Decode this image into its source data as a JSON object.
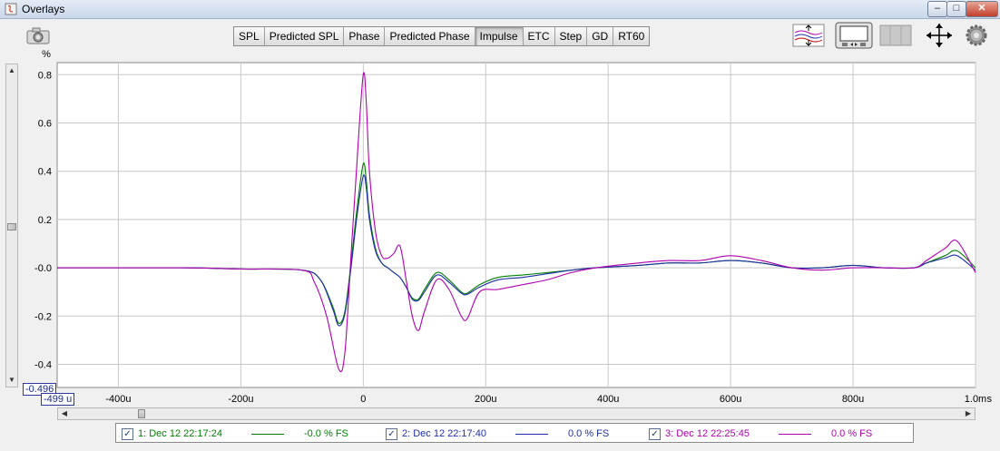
{
  "window": {
    "title": "Overlays"
  },
  "window_buttons": {
    "minimize": "–",
    "maximize": "□",
    "close": "✕"
  },
  "tabs": [
    {
      "label": "SPL",
      "active": false
    },
    {
      "label": "Predicted SPL",
      "active": false
    },
    {
      "label": "Phase",
      "active": false
    },
    {
      "label": "Predicted Phase",
      "active": false
    },
    {
      "label": "Impulse",
      "active": true
    },
    {
      "label": "ETC",
      "active": false
    },
    {
      "label": "Step",
      "active": false
    },
    {
      "label": "GD",
      "active": false
    },
    {
      "label": "RT60",
      "active": false
    }
  ],
  "toolbar_icons": [
    "vertical-zoom-icon",
    "display-mode-icon",
    "grid-icon",
    "move-arrows-icon",
    "gear-icon"
  ],
  "colors": {
    "series1": "#008000",
    "series2": "#1f2fa8",
    "series3": "#b000b0",
    "grid": "#c8c8c8",
    "axis_text": "#000000"
  },
  "readouts": {
    "y_cursor": "-0.496",
    "x_cursor": "-499 u"
  },
  "chart_data": {
    "type": "line",
    "ylabel": "%",
    "xunit": "s",
    "xlim": [
      -0.0005,
      0.001
    ],
    "ylim": [
      -0.496,
      0.85
    ],
    "xticks": [
      {
        "value": -0.0004,
        "label": "-400u"
      },
      {
        "value": -0.0002,
        "label": "-200u"
      },
      {
        "value": 0,
        "label": "0"
      },
      {
        "value": 0.0002,
        "label": "200u"
      },
      {
        "value": 0.0004,
        "label": "400u"
      },
      {
        "value": 0.0006,
        "label": "600u"
      },
      {
        "value": 0.0008,
        "label": "800u"
      },
      {
        "value": 0.001,
        "label": "1.0m"
      }
    ],
    "yticks": [
      {
        "value": 0.8,
        "label": "0.8"
      },
      {
        "value": 0.6,
        "label": "0.6"
      },
      {
        "value": 0.4,
        "label": "0.4"
      },
      {
        "value": 0.2,
        "label": "0.2"
      },
      {
        "value": 0.0,
        "label": "-0.0"
      },
      {
        "value": -0.2,
        "label": "-0.2"
      },
      {
        "value": -0.4,
        "label": "-0.4"
      }
    ],
    "grid": true,
    "series": [
      {
        "name": "1: Dec 12 22:17:24",
        "legend_value": "-0.0 % FS",
        "color": "#008000",
        "checked": true,
        "x": [
          -0.0005,
          -0.0003,
          -0.0002,
          -0.0001,
          -7e-05,
          -5e-05,
          -4e-05,
          -3e-05,
          -2e-05,
          -1e-05,
          0,
          5e-06,
          1e-05,
          2e-05,
          3e-05,
          4e-05,
          5e-05,
          6e-05,
          7e-05,
          8e-05,
          9e-05,
          0.0001,
          0.00012,
          0.00014,
          0.00016,
          0.00017,
          0.00019,
          0.00022,
          0.00026,
          0.0003,
          0.00034,
          0.00038,
          0.00045,
          0.0005,
          0.00055,
          0.0006,
          0.00065,
          0.0007,
          0.00075,
          0.0008,
          0.00085,
          0.0009,
          0.00092,
          0.00095,
          0.00097,
          0.001
        ],
        "y": [
          0,
          0,
          -0.005,
          -0.01,
          -0.05,
          -0.16,
          -0.23,
          -0.18,
          0.02,
          0.25,
          0.43,
          0.36,
          0.22,
          0.08,
          0.02,
          0.0,
          -0.02,
          -0.04,
          -0.08,
          -0.125,
          -0.13,
          -0.09,
          -0.02,
          -0.05,
          -0.1,
          -0.105,
          -0.07,
          -0.04,
          -0.03,
          -0.02,
          -0.01,
          0.0,
          0.01,
          0.02,
          0.02,
          0.03,
          0.02,
          0.0,
          0.0,
          0.01,
          0.0,
          0.0,
          0.02,
          0.05,
          0.07,
          0.0
        ]
      },
      {
        "name": "2: Dec 12 22:17:40",
        "legend_value": "0.0 % FS",
        "color": "#1f2fa8",
        "checked": true,
        "x": [
          -0.0005,
          -0.0003,
          -0.0002,
          -0.0001,
          -7e-05,
          -5e-05,
          -4e-05,
          -3e-05,
          -2e-05,
          -1e-05,
          0,
          5e-06,
          1e-05,
          2e-05,
          3e-05,
          4e-05,
          5e-05,
          6e-05,
          7e-05,
          8e-05,
          9e-05,
          0.0001,
          0.00012,
          0.00014,
          0.00016,
          0.00017,
          0.00019,
          0.00022,
          0.00026,
          0.0003,
          0.00034,
          0.00038,
          0.00045,
          0.0005,
          0.00055,
          0.0006,
          0.00065,
          0.0007,
          0.00075,
          0.0008,
          0.00085,
          0.0009,
          0.00092,
          0.00095,
          0.00097,
          0.001
        ],
        "y": [
          0,
          0,
          -0.005,
          -0.01,
          -0.05,
          -0.17,
          -0.24,
          -0.19,
          0.0,
          0.22,
          0.38,
          0.33,
          0.2,
          0.07,
          0.02,
          0.0,
          -0.02,
          -0.04,
          -0.08,
          -0.13,
          -0.135,
          -0.1,
          -0.03,
          -0.06,
          -0.105,
          -0.11,
          -0.08,
          -0.05,
          -0.04,
          -0.025,
          -0.01,
          0.0,
          0.01,
          0.02,
          0.02,
          0.03,
          0.02,
          0.0,
          0.0,
          0.01,
          0.0,
          0.0,
          0.02,
          0.04,
          0.05,
          -0.01
        ]
      },
      {
        "name": "3: Dec 12 22:25:45",
        "legend_value": "0.0 % FS",
        "color": "#b000b0",
        "checked": true,
        "x": [
          -0.0005,
          -0.0003,
          -0.0002,
          -0.0001,
          -8e-05,
          -6e-05,
          -4e-05,
          -3e-05,
          -2e-05,
          -1e-05,
          0,
          5e-06,
          1e-05,
          2e-05,
          3e-05,
          4e-05,
          5e-05,
          6e-05,
          7e-05,
          8e-05,
          9e-05,
          0.0001,
          0.00012,
          0.00014,
          0.00016,
          0.00017,
          0.00019,
          0.00022,
          0.00026,
          0.0003,
          0.00034,
          0.00038,
          0.00045,
          0.0005,
          0.00055,
          0.0006,
          0.00065,
          0.0007,
          0.00075,
          0.0008,
          0.00085,
          0.0009,
          0.00092,
          0.00095,
          0.00097,
          0.001
        ],
        "y": [
          0,
          0,
          -0.005,
          -0.01,
          -0.06,
          -0.2,
          -0.42,
          -0.35,
          0.05,
          0.45,
          0.8,
          0.68,
          0.4,
          0.15,
          0.05,
          0.04,
          0.06,
          0.09,
          -0.05,
          -0.2,
          -0.26,
          -0.18,
          -0.05,
          -0.09,
          -0.2,
          -0.21,
          -0.1,
          -0.09,
          -0.07,
          -0.05,
          -0.02,
          0.0,
          0.02,
          0.03,
          0.03,
          0.05,
          0.03,
          0.0,
          -0.01,
          0.0,
          0.0,
          0.0,
          0.03,
          0.08,
          0.11,
          -0.02
        ]
      }
    ]
  }
}
